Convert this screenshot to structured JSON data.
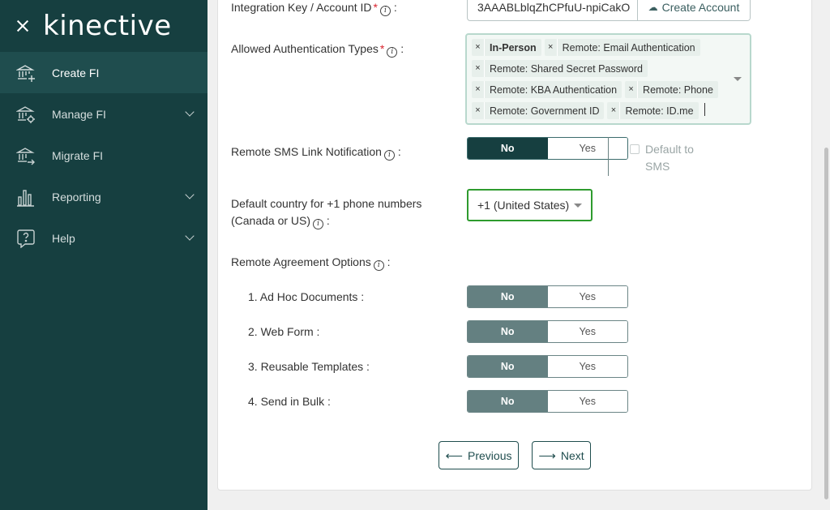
{
  "sidebar": {
    "logo": "kinective",
    "items": [
      {
        "label": "Create FI",
        "icon": "bank-plus-icon",
        "active": true,
        "expandable": false
      },
      {
        "label": "Manage FI",
        "icon": "bank-gear-icon",
        "active": false,
        "expandable": true
      },
      {
        "label": "Migrate FI",
        "icon": "bank-arrow-icon",
        "active": false,
        "expandable": false
      },
      {
        "label": "Reporting",
        "icon": "bar-chart-icon",
        "active": false,
        "expandable": true
      },
      {
        "label": "Help",
        "icon": "question-bubble-icon",
        "active": false,
        "expandable": true
      }
    ]
  },
  "form": {
    "integration_key": {
      "label": "Integration Key / Account ID",
      "required": "*",
      "value": "3AAABLblqZhCPfuU-npiCakO",
      "button": "Create Account"
    },
    "auth_types": {
      "label": "Allowed Authentication Types",
      "required": "*",
      "chips": [
        "In-Person",
        "Remote: Email Authentication",
        "Remote: Shared Secret Password",
        "Remote: KBA Authentication",
        "Remote: Phone",
        "Remote: Government ID",
        "Remote: ID.me"
      ]
    },
    "sms_link": {
      "label": "Remote SMS Link Notification",
      "no": "No",
      "yes": "Yes",
      "selected": "No",
      "default_sms_line1": "Default to",
      "default_sms_line2": "SMS"
    },
    "country": {
      "label_line1": "Default country for +1 phone numbers",
      "label_line2": "(Canada or US)",
      "value": "+1 (United States)"
    },
    "agreement": {
      "label": "Remote Agreement Options",
      "options": [
        {
          "label": "1. Ad Hoc Documents :",
          "no": "No",
          "yes": "Yes",
          "selected": "No"
        },
        {
          "label": "2. Web Form :",
          "no": "No",
          "yes": "Yes",
          "selected": "No"
        },
        {
          "label": "3. Reusable Templates :",
          "no": "No",
          "yes": "Yes",
          "selected": "No"
        },
        {
          "label": "4. Send in Bulk :",
          "no": "No",
          "yes": "Yes",
          "selected": "No"
        }
      ]
    },
    "nav": {
      "previous": "Previous",
      "next": "Next"
    }
  },
  "colors": {
    "sidebar_bg": "#163f40",
    "sidebar_active": "#1f4d4e",
    "accent": "#163f40",
    "muted_toggle": "#648081",
    "focus_green": "#2e9b2e",
    "required_red": "#d9232e"
  }
}
